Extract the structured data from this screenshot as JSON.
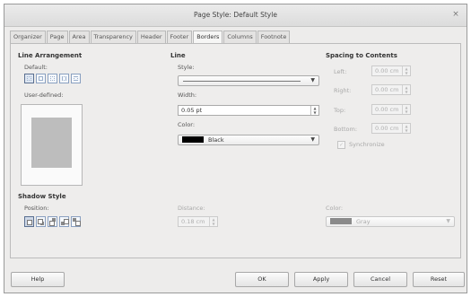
{
  "window": {
    "title": "Page Style: Default Style",
    "close_glyph": "×"
  },
  "tabs": [
    {
      "label": "Organizer"
    },
    {
      "label": "Page"
    },
    {
      "label": "Area"
    },
    {
      "label": "Transparency"
    },
    {
      "label": "Header"
    },
    {
      "label": "Footer"
    },
    {
      "label": "Borders",
      "active": true
    },
    {
      "label": "Columns"
    },
    {
      "label": "Footnote"
    }
  ],
  "line_arrangement": {
    "title": "Line Arrangement",
    "default_label": "Default:",
    "user_defined_label": "User-defined:"
  },
  "line": {
    "title": "Line",
    "style_label": "Style:",
    "width_label": "Width:",
    "width_value": "0.05 pt",
    "color_label": "Color:",
    "color_value": "Black",
    "color_hex": "#000000"
  },
  "spacing": {
    "title": "Spacing to Contents",
    "left_label": "Left:",
    "left_value": "0.00 cm",
    "right_label": "Right:",
    "right_value": "0.00 cm",
    "top_label": "Top:",
    "top_value": "0.00 cm",
    "bottom_label": "Bottom:",
    "bottom_value": "0.00 cm",
    "synchronize_label": "Synchronize",
    "synchronize_checked": true
  },
  "shadow": {
    "title": "Shadow Style",
    "position_label": "Position:",
    "distance_label": "Distance:",
    "distance_value": "0.18 cm",
    "color_label": "Color:",
    "color_value": "Gray",
    "color_hex": "#8a8a8a"
  },
  "buttons": {
    "help": "Help",
    "ok": "OK",
    "apply": "Apply",
    "cancel": "Cancel",
    "reset": "Reset"
  },
  "icons": [
    "close-icon",
    "dropdown-arrow-icon",
    "spin-up-icon",
    "spin-down-icon",
    "checkmark-icon"
  ]
}
